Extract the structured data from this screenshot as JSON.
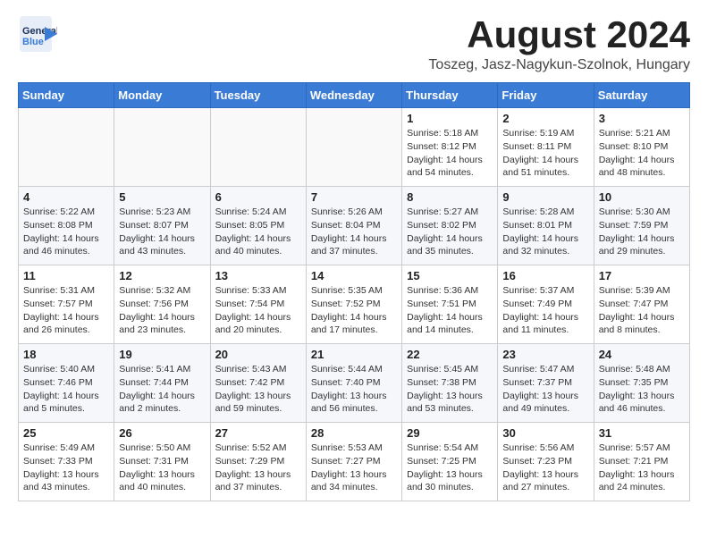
{
  "header": {
    "logo_line1": "General",
    "logo_line2": "Blue",
    "month": "August 2024",
    "location": "Toszeg, Jasz-Nagykun-Szolnok, Hungary"
  },
  "days_of_week": [
    "Sunday",
    "Monday",
    "Tuesday",
    "Wednesday",
    "Thursday",
    "Friday",
    "Saturday"
  ],
  "weeks": [
    [
      {
        "day": "",
        "info": ""
      },
      {
        "day": "",
        "info": ""
      },
      {
        "day": "",
        "info": ""
      },
      {
        "day": "",
        "info": ""
      },
      {
        "day": "1",
        "info": "Sunrise: 5:18 AM\nSunset: 8:12 PM\nDaylight: 14 hours\nand 54 minutes."
      },
      {
        "day": "2",
        "info": "Sunrise: 5:19 AM\nSunset: 8:11 PM\nDaylight: 14 hours\nand 51 minutes."
      },
      {
        "day": "3",
        "info": "Sunrise: 5:21 AM\nSunset: 8:10 PM\nDaylight: 14 hours\nand 48 minutes."
      }
    ],
    [
      {
        "day": "4",
        "info": "Sunrise: 5:22 AM\nSunset: 8:08 PM\nDaylight: 14 hours\nand 46 minutes."
      },
      {
        "day": "5",
        "info": "Sunrise: 5:23 AM\nSunset: 8:07 PM\nDaylight: 14 hours\nand 43 minutes."
      },
      {
        "day": "6",
        "info": "Sunrise: 5:24 AM\nSunset: 8:05 PM\nDaylight: 14 hours\nand 40 minutes."
      },
      {
        "day": "7",
        "info": "Sunrise: 5:26 AM\nSunset: 8:04 PM\nDaylight: 14 hours\nand 37 minutes."
      },
      {
        "day": "8",
        "info": "Sunrise: 5:27 AM\nSunset: 8:02 PM\nDaylight: 14 hours\nand 35 minutes."
      },
      {
        "day": "9",
        "info": "Sunrise: 5:28 AM\nSunset: 8:01 PM\nDaylight: 14 hours\nand 32 minutes."
      },
      {
        "day": "10",
        "info": "Sunrise: 5:30 AM\nSunset: 7:59 PM\nDaylight: 14 hours\nand 29 minutes."
      }
    ],
    [
      {
        "day": "11",
        "info": "Sunrise: 5:31 AM\nSunset: 7:57 PM\nDaylight: 14 hours\nand 26 minutes."
      },
      {
        "day": "12",
        "info": "Sunrise: 5:32 AM\nSunset: 7:56 PM\nDaylight: 14 hours\nand 23 minutes."
      },
      {
        "day": "13",
        "info": "Sunrise: 5:33 AM\nSunset: 7:54 PM\nDaylight: 14 hours\nand 20 minutes."
      },
      {
        "day": "14",
        "info": "Sunrise: 5:35 AM\nSunset: 7:52 PM\nDaylight: 14 hours\nand 17 minutes."
      },
      {
        "day": "15",
        "info": "Sunrise: 5:36 AM\nSunset: 7:51 PM\nDaylight: 14 hours\nand 14 minutes."
      },
      {
        "day": "16",
        "info": "Sunrise: 5:37 AM\nSunset: 7:49 PM\nDaylight: 14 hours\nand 11 minutes."
      },
      {
        "day": "17",
        "info": "Sunrise: 5:39 AM\nSunset: 7:47 PM\nDaylight: 14 hours\nand 8 minutes."
      }
    ],
    [
      {
        "day": "18",
        "info": "Sunrise: 5:40 AM\nSunset: 7:46 PM\nDaylight: 14 hours\nand 5 minutes."
      },
      {
        "day": "19",
        "info": "Sunrise: 5:41 AM\nSunset: 7:44 PM\nDaylight: 14 hours\nand 2 minutes."
      },
      {
        "day": "20",
        "info": "Sunrise: 5:43 AM\nSunset: 7:42 PM\nDaylight: 13 hours\nand 59 minutes."
      },
      {
        "day": "21",
        "info": "Sunrise: 5:44 AM\nSunset: 7:40 PM\nDaylight: 13 hours\nand 56 minutes."
      },
      {
        "day": "22",
        "info": "Sunrise: 5:45 AM\nSunset: 7:38 PM\nDaylight: 13 hours\nand 53 minutes."
      },
      {
        "day": "23",
        "info": "Sunrise: 5:47 AM\nSunset: 7:37 PM\nDaylight: 13 hours\nand 49 minutes."
      },
      {
        "day": "24",
        "info": "Sunrise: 5:48 AM\nSunset: 7:35 PM\nDaylight: 13 hours\nand 46 minutes."
      }
    ],
    [
      {
        "day": "25",
        "info": "Sunrise: 5:49 AM\nSunset: 7:33 PM\nDaylight: 13 hours\nand 43 minutes."
      },
      {
        "day": "26",
        "info": "Sunrise: 5:50 AM\nSunset: 7:31 PM\nDaylight: 13 hours\nand 40 minutes."
      },
      {
        "day": "27",
        "info": "Sunrise: 5:52 AM\nSunset: 7:29 PM\nDaylight: 13 hours\nand 37 minutes."
      },
      {
        "day": "28",
        "info": "Sunrise: 5:53 AM\nSunset: 7:27 PM\nDaylight: 13 hours\nand 34 minutes."
      },
      {
        "day": "29",
        "info": "Sunrise: 5:54 AM\nSunset: 7:25 PM\nDaylight: 13 hours\nand 30 minutes."
      },
      {
        "day": "30",
        "info": "Sunrise: 5:56 AM\nSunset: 7:23 PM\nDaylight: 13 hours\nand 27 minutes."
      },
      {
        "day": "31",
        "info": "Sunrise: 5:57 AM\nSunset: 7:21 PM\nDaylight: 13 hours\nand 24 minutes."
      }
    ]
  ]
}
